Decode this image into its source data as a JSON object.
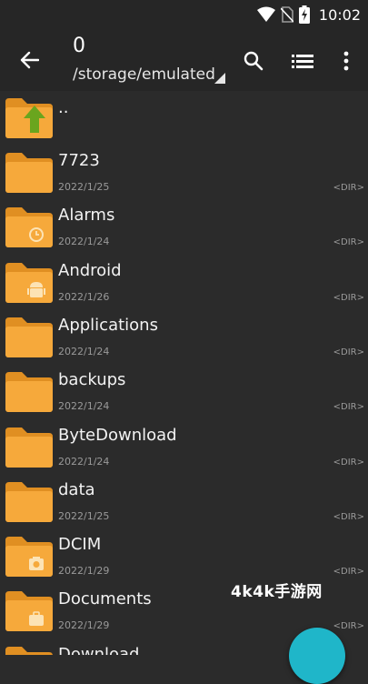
{
  "status": {
    "time": "10:02"
  },
  "toolbar": {
    "title": "0",
    "path": "/storage/emulated"
  },
  "parent_entry": {
    "name": ".."
  },
  "files": [
    {
      "name": "7723",
      "date": "2022/1/25",
      "type": "<DIR>",
      "badge": "none"
    },
    {
      "name": "Alarms",
      "date": "2022/1/24",
      "type": "<DIR>",
      "badge": "alarm-clock-icon"
    },
    {
      "name": "Android",
      "date": "2022/1/26",
      "type": "<DIR>",
      "badge": "android-icon"
    },
    {
      "name": "Applications",
      "date": "2022/1/24",
      "type": "<DIR>",
      "badge": "none"
    },
    {
      "name": "backups",
      "date": "2022/1/24",
      "type": "<DIR>",
      "badge": "none"
    },
    {
      "name": "ByteDownload",
      "date": "2022/1/24",
      "type": "<DIR>",
      "badge": "none"
    },
    {
      "name": "data",
      "date": "2022/1/25",
      "type": "<DIR>",
      "badge": "none"
    },
    {
      "name": "DCIM",
      "date": "2022/1/29",
      "type": "<DIR>",
      "badge": "camera-icon"
    },
    {
      "name": "Documents",
      "date": "2022/1/29",
      "type": "<DIR>",
      "badge": "briefcase-icon"
    },
    {
      "name": "Download",
      "date": "",
      "type": "",
      "badge": "download-icon"
    }
  ],
  "watermark": "4k4k手游网",
  "colors": {
    "background": "#2b2b2b",
    "toolbar": "#262626",
    "folder": "#f6a93b",
    "folder_tab": "#e08f22",
    "fab": "#1fb6c9"
  }
}
